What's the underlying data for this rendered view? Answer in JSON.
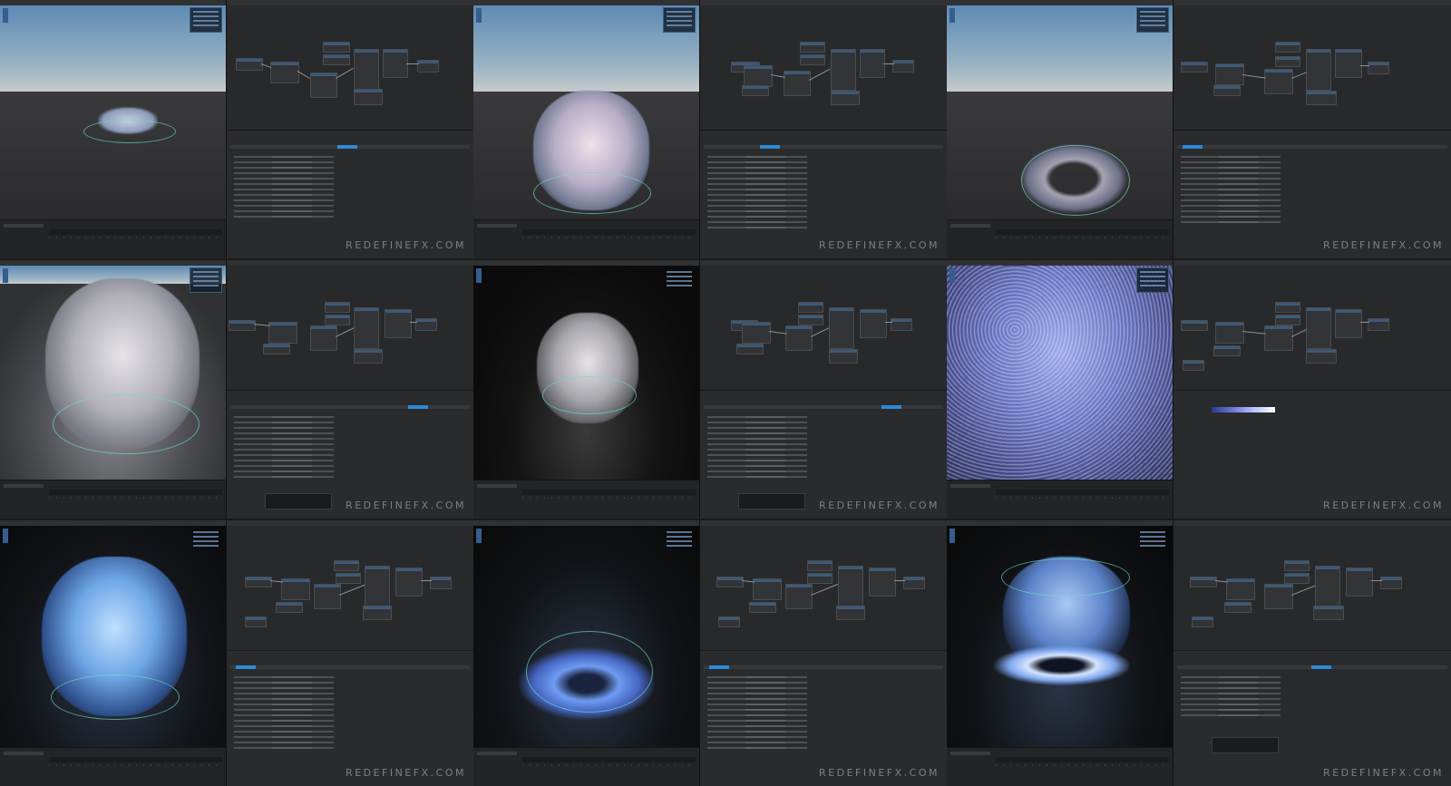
{
  "watermark": "REDEFINEFX.COM",
  "colors": {
    "accent": "#2d8ad6",
    "background": "#1b1b1c",
    "particle_white": "#e9e4ea",
    "particle_blue": "#7fb0ff"
  },
  "panels": [
    {
      "id": "r1c1",
      "kind": "viewport",
      "scene": "sky"
    },
    {
      "id": "r1c2",
      "kind": "editor"
    },
    {
      "id": "r1c3",
      "kind": "viewport",
      "scene": "sky"
    },
    {
      "id": "r1c4",
      "kind": "editor"
    },
    {
      "id": "r1c5",
      "kind": "viewport",
      "scene": "sky"
    },
    {
      "id": "r1c6",
      "kind": "editor"
    },
    {
      "id": "r2c1",
      "kind": "viewport",
      "scene": "sky"
    },
    {
      "id": "r2c2",
      "kind": "editor"
    },
    {
      "id": "r2c3",
      "kind": "viewport",
      "scene": "dark"
    },
    {
      "id": "r2c4",
      "kind": "editor"
    },
    {
      "id": "r2c5",
      "kind": "viewport",
      "scene": "dense-blue"
    },
    {
      "id": "r2c6",
      "kind": "editor"
    },
    {
      "id": "r3c1",
      "kind": "viewport",
      "scene": "dark-blue"
    },
    {
      "id": "r3c2",
      "kind": "editor"
    },
    {
      "id": "r3c3",
      "kind": "viewport",
      "scene": "dark-blue"
    },
    {
      "id": "r3c4",
      "kind": "editor"
    },
    {
      "id": "r3c5",
      "kind": "viewport",
      "scene": "dark-blue"
    },
    {
      "id": "r3c6",
      "kind": "editor"
    }
  ]
}
